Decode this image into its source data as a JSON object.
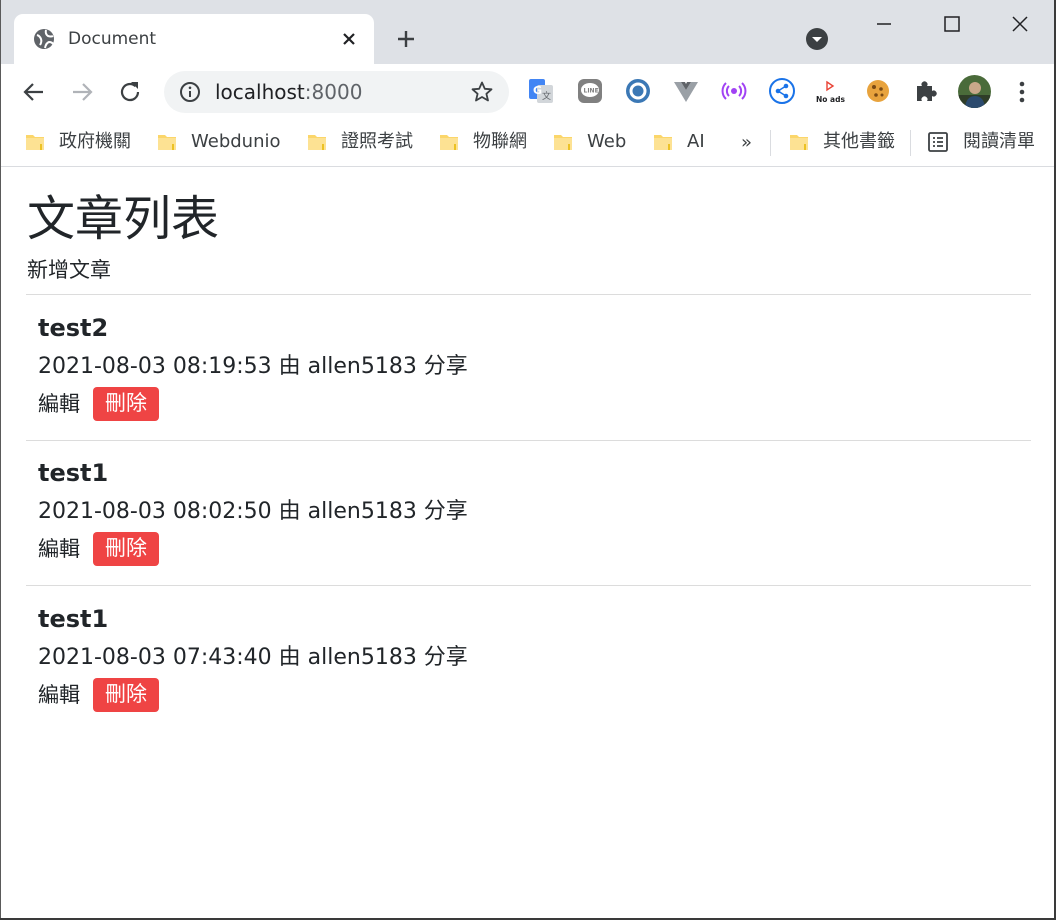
{
  "browser": {
    "tab_title": "Document",
    "url_host": "localhost",
    "url_port": ":8000",
    "accent_bar_color": "#dee1e6",
    "extensions": [
      "translate-icon",
      "line-icon",
      "o-extension-icon",
      "vue-devtools-icon",
      "broadcast-icon",
      "share-icon",
      "no-ads-icon",
      "cookie-icon",
      "puzzle-icon"
    ],
    "noads_label": "No ads"
  },
  "bookmarks": {
    "items": [
      {
        "label": "政府機關"
      },
      {
        "label": "Webdunio"
      },
      {
        "label": "證照考試"
      },
      {
        "label": "物聯網"
      },
      {
        "label": "Web"
      },
      {
        "label": "AI"
      }
    ],
    "overflow": "»",
    "other": "其他書籤",
    "reading_list": "閱讀清單"
  },
  "page": {
    "title": "文章列表",
    "add_link": "新增文章",
    "delete_color": "#ef4444",
    "posts": [
      {
        "title": "test2",
        "meta": "2021-08-03 08:19:53 由 allen5183 分享",
        "edit": "編輯",
        "delete": "刪除"
      },
      {
        "title": "test1",
        "meta": "2021-08-03 08:02:50 由 allen5183 分享",
        "edit": "編輯",
        "delete": "刪除"
      },
      {
        "title": "test1",
        "meta": "2021-08-03 07:43:40 由 allen5183 分享",
        "edit": "編輯",
        "delete": "刪除"
      }
    ]
  }
}
